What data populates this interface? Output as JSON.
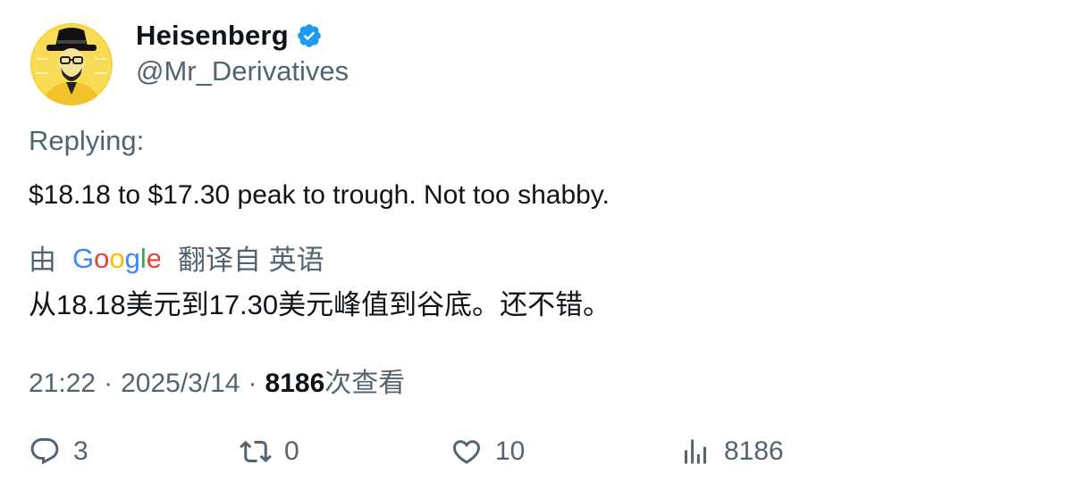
{
  "tweet": {
    "author": {
      "name": "Heisenberg",
      "handle": "@Mr_Derivatives",
      "verified": true
    },
    "replying_label": "Replying:",
    "text": "$18.18 to $17.30 peak to trough. Not too shabby.",
    "translation": {
      "by_label": "由",
      "logo_text": "Google",
      "translated_from_label": "翻译自 英语",
      "text": "从18.18美元到17.30美元峰值到谷底。还不错。"
    },
    "meta": {
      "time": "21:22",
      "separator": "·",
      "date": "2025/3/14",
      "views_count": "8186",
      "views_label": "次查看"
    },
    "actions": {
      "replies": "3",
      "retweets": "0",
      "likes": "10",
      "views": "8186"
    }
  },
  "colors": {
    "text_primary": "#0f1419",
    "text_secondary": "#536471",
    "verified_blue": "#1d9bf0",
    "avatar_yellow": "#f7d33c"
  },
  "icons": {
    "verified": "verified-badge-icon",
    "reply": "reply-icon",
    "retweet": "retweet-icon",
    "like": "heart-icon",
    "views": "bar-chart-icon"
  }
}
